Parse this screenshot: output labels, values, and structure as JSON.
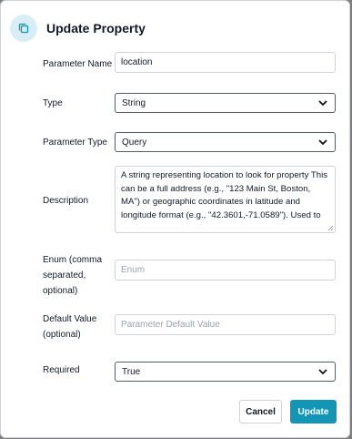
{
  "dialog": {
    "title": "Update Property",
    "icon": "copy-icon",
    "accent_color": "#1396b6",
    "icon_bg_color": "#d7eef6"
  },
  "fields": {
    "parameter_name": {
      "label": "Parameter Name",
      "value": "location"
    },
    "type": {
      "label": "Type",
      "value": "String"
    },
    "parameter_type": {
      "label": "Parameter Type",
      "value": "Query"
    },
    "description": {
      "label": "Description",
      "value": "A string representing location to look for property This can be a full address (e.g., \"123 Main St, Boston, MA\") or geographic coordinates in latitude and longitude format (e.g., \"42.3601,-71.0589\"). Used to"
    },
    "enum": {
      "label_line1": "Enum (comma",
      "label_line2": "separated,",
      "label_line3": "optional)",
      "placeholder": "Enum"
    },
    "default_value": {
      "label_line1": "Default Value",
      "label_line2": "(optional)",
      "placeholder": "Parameter Default Value"
    },
    "required": {
      "label": "Required",
      "value": "True"
    }
  },
  "buttons": {
    "cancel": "Cancel",
    "update": "Update"
  }
}
